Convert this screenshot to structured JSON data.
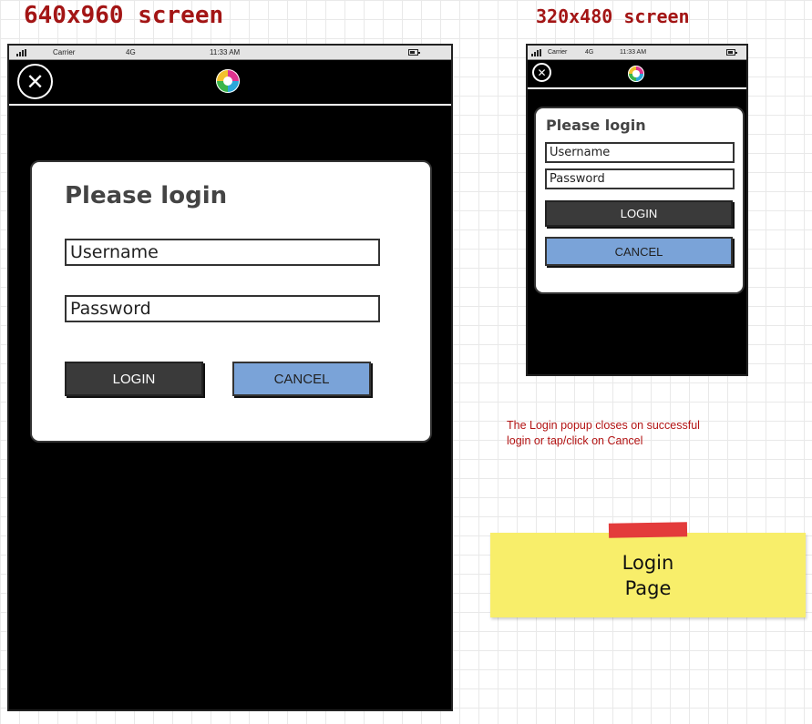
{
  "large_screen": {
    "heading": "640x960 screen",
    "status_bar": {
      "carrier": "Carrier",
      "network": "4G",
      "time": "11:33 AM"
    },
    "dialog": {
      "title": "Please login",
      "username_placeholder": "Username",
      "password_placeholder": "Password",
      "login_label": "LOGIN",
      "cancel_label": "CANCEL"
    }
  },
  "small_screen": {
    "heading": "320x480 screen",
    "status_bar": {
      "carrier": "Carrier",
      "network": "4G",
      "time": "11:33 AM"
    },
    "dialog": {
      "title": "Please login",
      "username_placeholder": "Username",
      "password_placeholder": "Password",
      "login_label": "LOGIN",
      "cancel_label": "CANCEL"
    }
  },
  "annotation": {
    "note": "The Login popup closes on successful login or tap/click on Cancel",
    "sticky_note": "Login\nPage"
  },
  "colors": {
    "heading": "#a31515",
    "cancel_button": "#7aa3d8",
    "login_button": "#3a3a3a",
    "sticky": "#f8ee6a",
    "tape": "#e33b3b"
  },
  "icons": {
    "close": "circled-x-icon",
    "logo": "app-logo-icon",
    "signal": "signal-bars-icon",
    "battery": "battery-icon"
  }
}
